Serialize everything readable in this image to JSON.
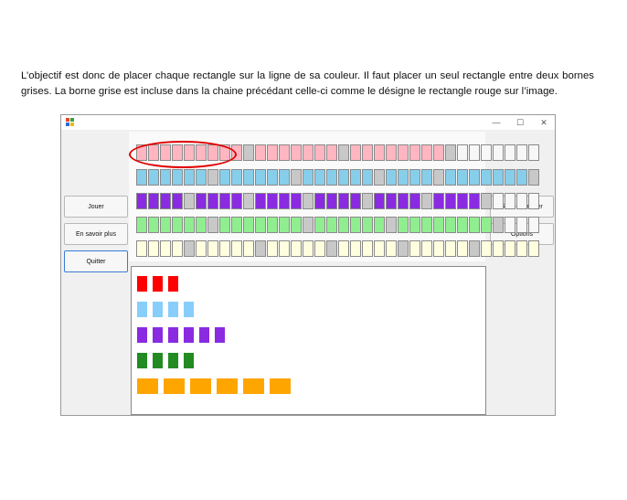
{
  "document": {
    "paragraph": "L’objectif est donc de placer chaque rectangle sur la ligne de sa couleur. Il faut placer un seul rectangle entre deux bornes grises. La borne grise est incluse dans la chaine précédant celle-ci comme le désigne le rectangle rouge sur l’image."
  },
  "window": {
    "buttons": {
      "play": "Jouer",
      "learn_more": "En savoir plus",
      "quit": "Quitter",
      "restart": "Recommencer",
      "options": "Options"
    },
    "controls": {
      "minimize": "—",
      "maximize": "☐",
      "close": "✕"
    }
  },
  "colors": {
    "gray": "#c8c8c8",
    "empty": "#f7f7f7",
    "pink": "#ffb6c1",
    "blue": "#87ceeb",
    "purple": "#8a2be2",
    "green": "#90ee90",
    "yellow": "#ffffe0",
    "piece_red": "#ff0000",
    "piece_blue": "#87cefa",
    "piece_purple": "#8a2be2",
    "piece_green": "#228b22",
    "piece_orange": "#ffa500",
    "highlight": "#e00000"
  },
  "board": {
    "rows": [
      {
        "color": "pink",
        "groups": [
          9,
          7,
          8
        ],
        "gray_after": true
      },
      {
        "color": "blue",
        "groups": [
          6,
          6,
          6,
          4,
          7
        ]
      },
      {
        "color": "purple",
        "groups": [
          4,
          4,
          4,
          4,
          4,
          4
        ]
      },
      {
        "color": "green",
        "groups": [
          6,
          7,
          6,
          8
        ]
      },
      {
        "color": "yellow",
        "groups": [
          4,
          5,
          5,
          5,
          5,
          5
        ]
      }
    ]
  },
  "pieces": [
    {
      "color": "piece_red",
      "count": 3,
      "shape": "tall"
    },
    {
      "color": "piece_blue",
      "count": 4,
      "shape": "tall"
    },
    {
      "color": "piece_purple",
      "count": 6,
      "shape": "tall"
    },
    {
      "color": "piece_green",
      "count": 4,
      "shape": "tall"
    },
    {
      "color": "piece_orange",
      "count": 6,
      "shape": "wide"
    }
  ]
}
